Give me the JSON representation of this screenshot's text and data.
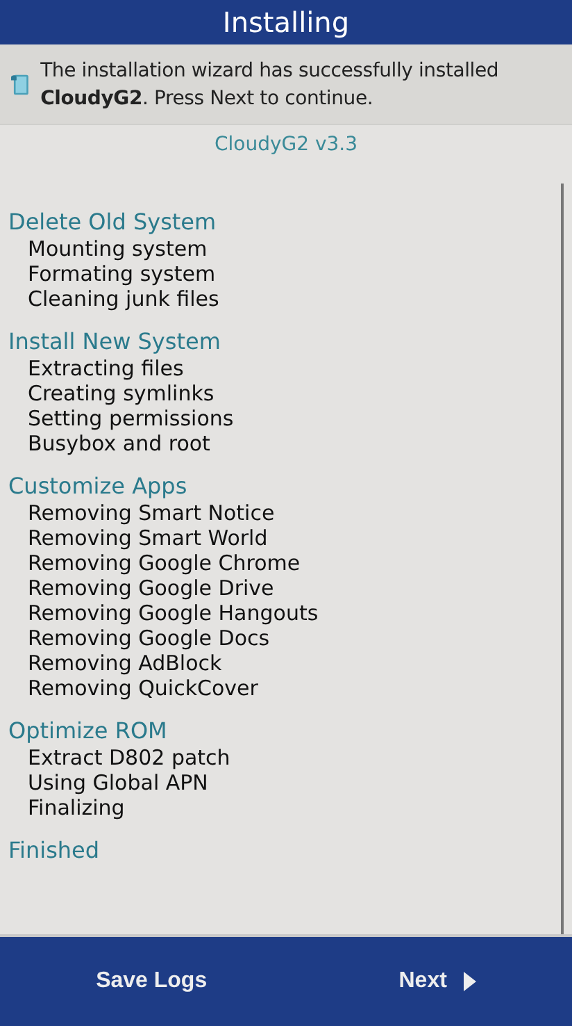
{
  "window": {
    "title": "Installing"
  },
  "banner": {
    "message": "The installation wizard has successfully installed **CloudyG2**. Press Next to continue."
  },
  "version": "CloudyG2 v3.3",
  "log": [
    {
      "title": "Delete Old System",
      "items": [
        "Mounting system",
        "Formating system",
        "Cleaning junk files"
      ]
    },
    {
      "title": "Install New System",
      "items": [
        "Extracting files",
        "Creating symlinks",
        "Setting permissions",
        "Busybox and root"
      ]
    },
    {
      "title": "Customize Apps",
      "items": [
        "Removing Smart Notice",
        "Removing Smart World",
        "Removing Google Chrome",
        "Removing Google Drive",
        "Removing Google Hangouts",
        "Removing Google Docs",
        "Removing AdBlock",
        "Removing QuickCover"
      ]
    },
    {
      "title": "Optimize ROM",
      "items": [
        "Extract D802 patch",
        "Using Global APN",
        "Finalizing"
      ]
    },
    {
      "title": "Finished"
    }
  ],
  "buttons": [
    {
      "label": "Save Logs",
      "kind": "plain"
    },
    {
      "label": "Next",
      "kind": "forward"
    }
  ]
}
